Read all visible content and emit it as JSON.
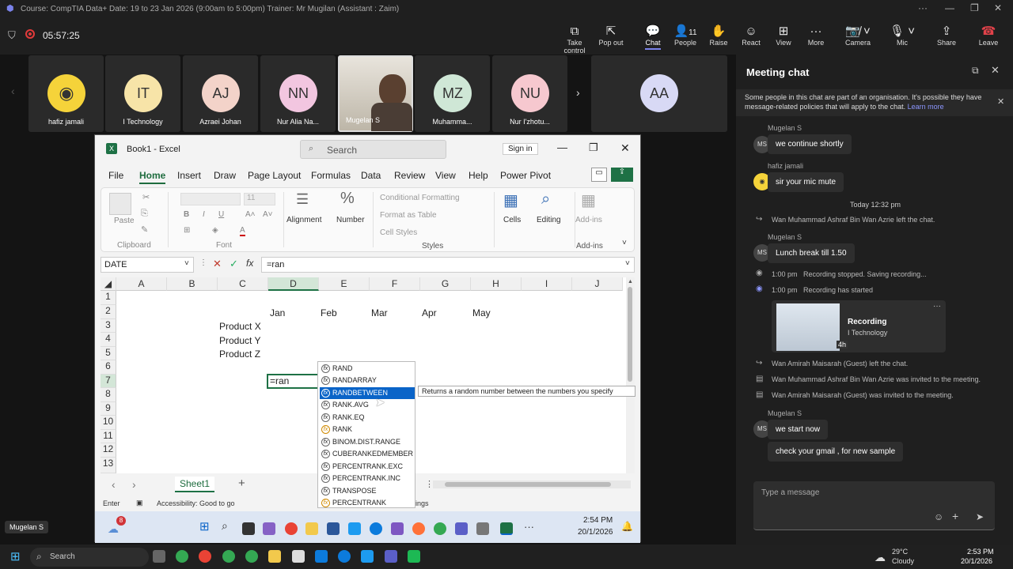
{
  "window": {
    "title": "Course: CompTIA Data+ Date: 19 to 23 Jan 2026 (9:00am to 5:00pm) Trainer: Mr Mugilan (Assistant : Zaim)",
    "controls": [
      "···",
      "—",
      "❐",
      "✕"
    ]
  },
  "meeting": {
    "timer": "05:57:25"
  },
  "toolbar": {
    "take_control": "Take control",
    "pop_out": "Pop out",
    "chat": "Chat",
    "people": "People",
    "people_count": "11",
    "raise": "Raise",
    "react": "React",
    "view": "View",
    "more": "More",
    "camera": "Camera",
    "mic": "Mic",
    "share": "Share",
    "leave": "Leave"
  },
  "participants": [
    {
      "name": "hafiz jamali",
      "initials": "",
      "color": "#f5d33a"
    },
    {
      "name": "I Technology",
      "initials": "IT",
      "color": "#f7e4a8"
    },
    {
      "name": "Azraei Johan",
      "initials": "AJ",
      "color": "#f3d3c9"
    },
    {
      "name": "Nur Alia Na...",
      "initials": "NN",
      "color": "#f2c6e0"
    },
    {
      "name": "Mugelan S",
      "initials": "",
      "color": "#888"
    },
    {
      "name": "Muhamma...",
      "initials": "MZ",
      "color": "#cfe7d6"
    },
    {
      "name": "Nur I'zhotu...",
      "initials": "NU",
      "color": "#f6c8cf"
    },
    {
      "name": "",
      "initials": "AA",
      "color": "#d8d9f5"
    }
  ],
  "stage_label": "Mugelan S",
  "excel": {
    "title": "Book1 - Excel",
    "search": "Search",
    "signin": "Sign in",
    "menu": [
      "File",
      "Home",
      "Insert",
      "Draw",
      "Page Layout",
      "Formulas",
      "Data",
      "Review",
      "View",
      "Help",
      "Power Pivot"
    ],
    "ribbon": {
      "paste": "Paste",
      "clipboard": "Clipboard",
      "font": "Font",
      "alignment": "Alignment",
      "number": "Number",
      "cond_format": "Conditional Formatting",
      "format_table": "Format as Table",
      "cell_styles": "Cell Styles",
      "styles": "Styles",
      "cells": "Cells",
      "editing": "Editing",
      "addins": "Add-ins",
      "addins_group": "Add-ins",
      "font_size": "11"
    },
    "namebox": "DATE",
    "formula": "=ran",
    "columns": [
      "A",
      "B",
      "C",
      "D",
      "E",
      "F",
      "G",
      "H",
      "I",
      "J"
    ],
    "rows": [
      "1",
      "2",
      "3",
      "4",
      "5",
      "6",
      "7",
      "8",
      "9",
      "10",
      "11",
      "12",
      "13"
    ],
    "cells": {
      "D2": "Jan",
      "E2": "Feb",
      "F2": "Mar",
      "G2": "Apr",
      "H2": "May",
      "C3": "Product X",
      "C4": "Product Y",
      "C5": "Product Z",
      "D7": "=ran"
    },
    "autocomplete": [
      "RAND",
      "RANDARRAY",
      "RANDBETWEEN",
      "RANK.AVG",
      "RANK.EQ",
      "RANK",
      "BINOM.DIST.RANGE",
      "CUBERANKEDMEMBER",
      "PERCENTRANK.EXC",
      "PERCENTRANK.INC",
      "TRANSPOSE",
      "PERCENTRANK"
    ],
    "tooltip": "Returns a random number between the numbers you specify",
    "sheet": "Sheet1",
    "status_mode": "Enter",
    "accessibility": "Accessibility: Good to go",
    "status_tail": "ings",
    "taskbar_time": "2:54 PM",
    "taskbar_date": "20/1/2026",
    "badge": "8"
  },
  "chat": {
    "title": "Meeting chat",
    "notice": "Some people in this chat are part of an organisation. It's possible they have message-related policies that will apply to the chat.",
    "learn_more": "Learn more",
    "m1_sender": "Mugelan S",
    "m1_text": "we continue shortly",
    "m2_sender": "hafiz jamali",
    "m2_text": "sir your mic mute",
    "time_divider": "Today 12:32 pm",
    "s1": "Wan Muhammad Ashraf Bin Wan Azrie left the chat.",
    "m3_sender": "Mugelan S",
    "m3_text": "Lunch break till 1.50",
    "s2_time": "1:00 pm",
    "s2": "Recording stopped. Saving recording...",
    "s3_time": "1:00 pm",
    "s3": "Recording has started",
    "rec_title": "Recording",
    "rec_sub": "I Technology",
    "rec_dur": "4h",
    "s4": "Wan Amirah Maisarah (Guest) left the chat.",
    "s5": "Wan Muhammad Ashraf Bin Wan Azrie was invited to the meeting.",
    "s6": "Wan Amirah Maisarah (Guest) was invited to the meeting.",
    "m4_sender": "Mugelan S",
    "m4_text": "we start now",
    "m5_text": "check your gmail , for new sample",
    "placeholder": "Type a message",
    "ms_initials": "MS"
  },
  "os": {
    "search": "Search",
    "temp": "29°C",
    "weather": "Cloudy",
    "time": "2:53 PM",
    "date": "20/1/2026"
  }
}
